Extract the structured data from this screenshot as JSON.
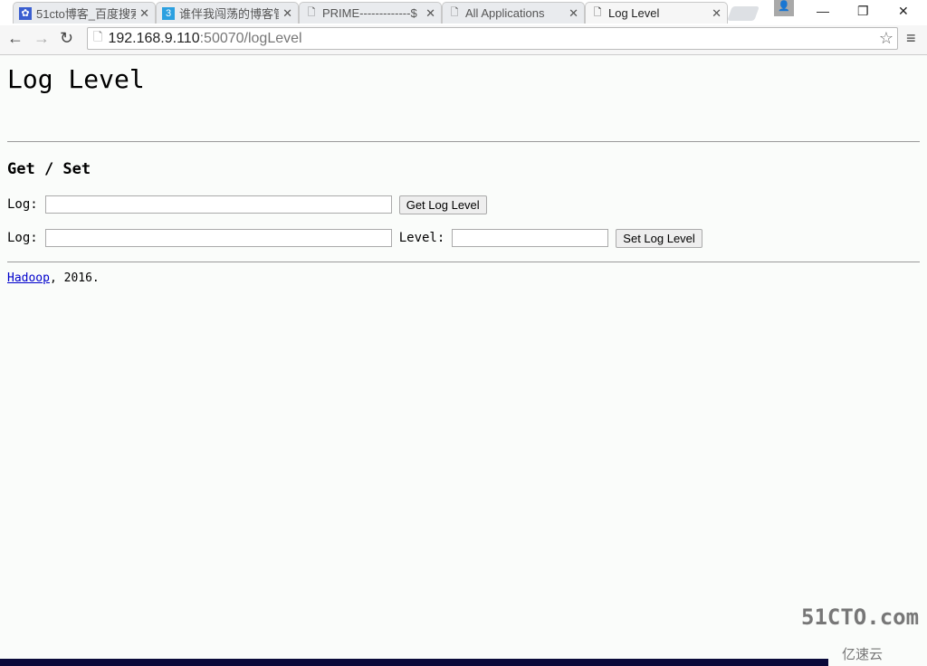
{
  "browser": {
    "tabs": [
      {
        "title": "51cto博客_百度搜索",
        "icon": "paw-icon",
        "active": false
      },
      {
        "title": "谁伴我闯荡的博客管",
        "icon": "blog-icon",
        "active": false
      },
      {
        "title": "PRIME-------------$",
        "icon": "page-icon",
        "active": false
      },
      {
        "title": "All Applications",
        "icon": "page-icon",
        "active": false
      },
      {
        "title": "Log Level",
        "icon": "page-icon",
        "active": true
      }
    ],
    "url_host": "192.168.9.110",
    "url_rest": ":50070/logLevel"
  },
  "page": {
    "title": "Log Level",
    "section": "Get / Set",
    "get_row": {
      "log_label": "Log:",
      "log_value": "",
      "button": "Get Log Level"
    },
    "set_row": {
      "log_label": "Log:",
      "log_value": "",
      "level_label": "Level:",
      "level_value": "",
      "button": "Set Log Level"
    },
    "footer_link": "Hadoop",
    "footer_text": ", 2016."
  },
  "watermark": {
    "line1": "51CTO.com",
    "line2": "亿速云"
  }
}
